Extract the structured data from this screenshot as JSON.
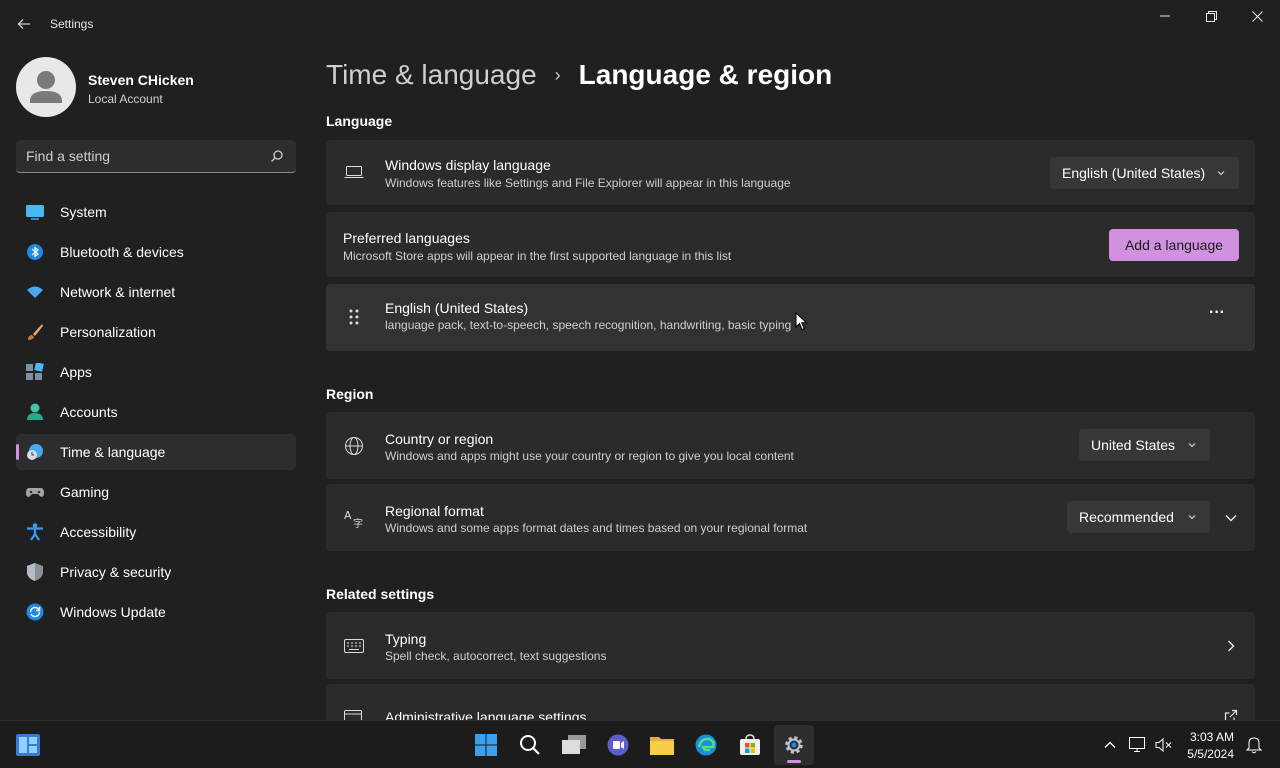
{
  "window": {
    "title": "Settings"
  },
  "user": {
    "name": "Steven CHicken",
    "account_type": "Local Account"
  },
  "search": {
    "placeholder": "Find a setting"
  },
  "sidebar": {
    "items": [
      {
        "label": "System",
        "icon": "system-icon"
      },
      {
        "label": "Bluetooth & devices",
        "icon": "bluetooth-icon"
      },
      {
        "label": "Network & internet",
        "icon": "network-icon"
      },
      {
        "label": "Personalization",
        "icon": "brush-icon"
      },
      {
        "label": "Apps",
        "icon": "apps-icon"
      },
      {
        "label": "Accounts",
        "icon": "accounts-icon"
      },
      {
        "label": "Time & language",
        "icon": "time-language-icon",
        "active": true
      },
      {
        "label": "Gaming",
        "icon": "gamepad-icon"
      },
      {
        "label": "Accessibility",
        "icon": "accessibility-icon"
      },
      {
        "label": "Privacy & security",
        "icon": "shield-icon"
      },
      {
        "label": "Windows Update",
        "icon": "update-icon"
      }
    ]
  },
  "breadcrumb": {
    "parent": "Time & language",
    "separator": "›",
    "current": "Language & region"
  },
  "language_section": {
    "title": "Language",
    "display_language": {
      "title": "Windows display language",
      "subtitle": "Windows features like Settings and File Explorer will appear in this language",
      "value": "English (United States)"
    },
    "preferred": {
      "title": "Preferred languages",
      "subtitle": "Microsoft Store apps will appear in the first supported language in this list",
      "button": "Add a language"
    },
    "language_item": {
      "title": "English (United States)",
      "subtitle": "language pack, text-to-speech, speech recognition, handwriting, basic typing",
      "more": "···"
    }
  },
  "region_section": {
    "title": "Region",
    "country": {
      "title": "Country or region",
      "subtitle": "Windows and apps might use your country or region to give you local content",
      "value": "United States"
    },
    "format": {
      "title": "Regional format",
      "subtitle": "Windows and some apps format dates and times based on your regional format",
      "value": "Recommended"
    }
  },
  "related_section": {
    "title": "Related settings",
    "typing": {
      "title": "Typing",
      "subtitle": "Spell check, autocorrect, text suggestions"
    },
    "admin": {
      "title": "Administrative language settings"
    }
  },
  "taskbar": {
    "time": "3:03 AM",
    "date": "5/5/2024"
  },
  "colors": {
    "accent": "#d190e0",
    "background": "#202020",
    "card": "#2b2b2b"
  }
}
